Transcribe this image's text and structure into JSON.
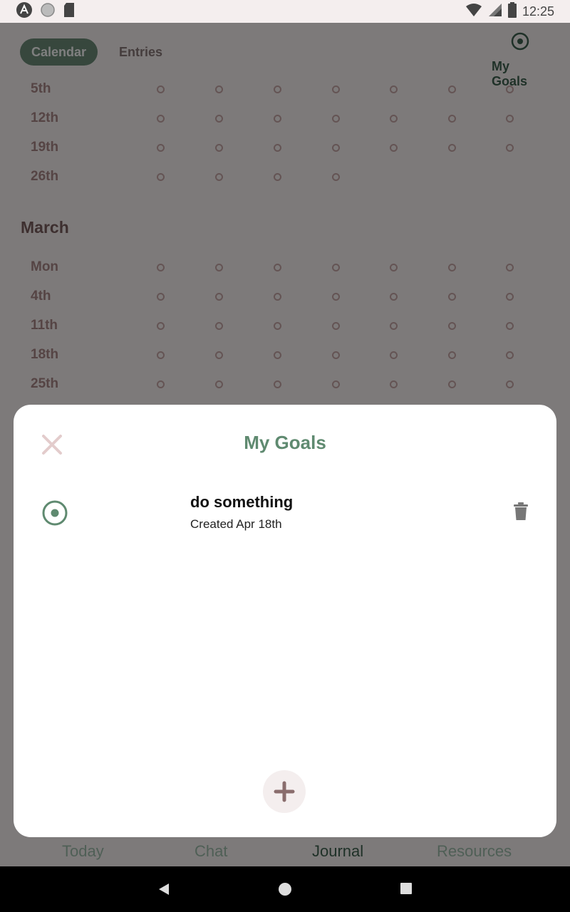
{
  "status_bar": {
    "time": "12:25"
  },
  "top_tabs": [
    {
      "label": "Calendar",
      "active": true
    },
    {
      "label": "Entries",
      "active": false
    }
  ],
  "goals_button": {
    "label": "My Goals",
    "icon": "target-icon"
  },
  "calendar": {
    "february_rows": [
      {
        "label": "5th",
        "dots": 7
      },
      {
        "label": "12th",
        "dots": 7
      },
      {
        "label": "19th",
        "dots": 7
      },
      {
        "label": "26th",
        "dots": 4
      }
    ],
    "march": {
      "title": "March",
      "rows": [
        {
          "label": "Mon",
          "dots": 7
        },
        {
          "label": "4th",
          "dots": 7
        },
        {
          "label": "11th",
          "dots": 7
        },
        {
          "label": "18th",
          "dots": 7
        },
        {
          "label": "25th",
          "dots": 7
        }
      ]
    }
  },
  "bottom_nav": [
    {
      "label": "Today",
      "active": false
    },
    {
      "label": "Chat",
      "active": false
    },
    {
      "label": "Journal",
      "active": true
    },
    {
      "label": "Resources",
      "active": false
    }
  ],
  "modal": {
    "title": "My Goals",
    "goals": [
      {
        "title": "do something",
        "created": "Created Apr 18th"
      }
    ],
    "colors": {
      "accent": "#5f8a70",
      "muted": "#c8b0b0"
    }
  }
}
